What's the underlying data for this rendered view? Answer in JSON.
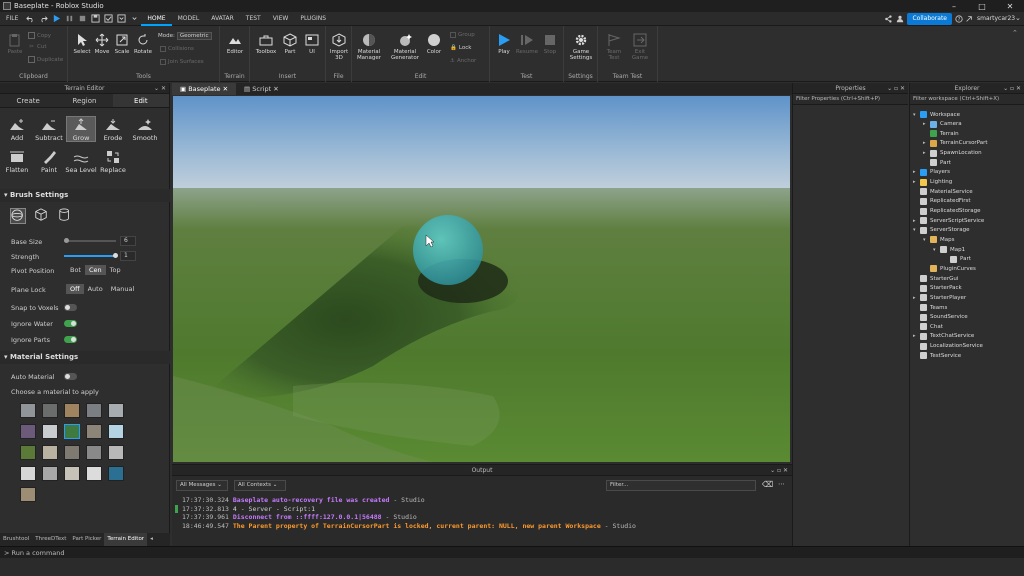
{
  "window": {
    "title": "Baseplate - Roblox Studio"
  },
  "menubar": {
    "items": [
      "FILE",
      "HOME",
      "MODEL",
      "AVATAR",
      "TEST",
      "VIEW",
      "PLUGINS"
    ],
    "active": "HOME",
    "collaborate": "Collaborate",
    "user": "smartycar23"
  },
  "ribbon": {
    "clipboard": {
      "paste": "Paste",
      "copy": "Copy",
      "cut": "Cut",
      "duplicate": "Duplicate",
      "label": "Clipboard"
    },
    "tools": {
      "select": "Select",
      "move": "Move",
      "scale": "Scale",
      "rotate": "Rotate",
      "mode_label": "Mode:",
      "mode_value": "Geometric",
      "collisions": "Collisions",
      "join": "Join Surfaces",
      "label": "Tools"
    },
    "terrain": {
      "editor": "Editor",
      "label": "Terrain"
    },
    "insert": {
      "toolbox": "Toolbox",
      "part": "Part",
      "ui": "UI",
      "label": "Insert"
    },
    "file": {
      "import": "Import 3D",
      "label": "File"
    },
    "edit": {
      "material": "Material Manager",
      "generator": "Material Generator",
      "color": "Color",
      "group": "Group",
      "lock": "Lock",
      "anchor": "Anchor",
      "label": "Edit"
    },
    "test": {
      "play": "Play",
      "resume": "Resume",
      "stop": "Stop",
      "label": "Test"
    },
    "settings": {
      "game": "Game Settings",
      "label": "Settings"
    },
    "teamtest": {
      "team": "Team Test",
      "exit": "Exit Game",
      "label": "Team Test"
    }
  },
  "terrain_editor": {
    "title": "Terrain Editor",
    "tabs": [
      "Create",
      "Region",
      "Edit"
    ],
    "active_tab": "Edit",
    "tools": [
      "Add",
      "Subtract",
      "Grow",
      "Erode",
      "Smooth",
      "Flatten",
      "Paint",
      "Sea Level",
      "Replace"
    ],
    "selected_tool": "Grow",
    "brush_settings": "Brush Settings",
    "base_size_label": "Base Size",
    "base_size": "6",
    "strength_label": "Strength",
    "strength": "1",
    "pivot_label": "Pivot Position",
    "pivot_options": [
      "Bot",
      "Cen",
      "Top"
    ],
    "pivot_selected": "Cen",
    "plane_label": "Plane Lock",
    "plane_options": [
      "Off",
      "Auto",
      "Manual"
    ],
    "plane_selected": "Off",
    "snap_label": "Snap to Voxels",
    "snap": false,
    "ignore_water_label": "Ignore Water",
    "ignore_water": true,
    "ignore_parts_label": "Ignore Parts",
    "ignore_parts": true,
    "material_settings": "Material Settings",
    "auto_material_label": "Auto Material",
    "auto_material": false,
    "choose_label": "Choose a material to apply"
  },
  "bottom_tabs": [
    "Brushtool",
    "ThreeDText",
    "Part Picker",
    "Terrain Editor"
  ],
  "viewport_tabs": [
    "Baseplate",
    "Script"
  ],
  "output": {
    "title": "Output",
    "filter1": "All Messages",
    "filter2": "All Contexts",
    "filter_placeholder": "Filter...",
    "lines": [
      {
        "time": "17:37:30.324",
        "text": "Baseplate auto-recovery file was created",
        "src": "Studio",
        "color": "#c77bff"
      },
      {
        "time": "17:37:32.813",
        "text": "4  -  Server - Script:1",
        "src": "",
        "color": "#cfcfcf"
      },
      {
        "time": "17:37:39.961",
        "text": "Disconnect from ::ffff:127.0.0.1|56488",
        "src": "Studio",
        "color": "#c77bff"
      },
      {
        "time": "18:46:49.547",
        "text": "The Parent property of TerrainCursorPart is locked, current parent: NULL, new parent Workspace",
        "src": "Studio",
        "color": "#ff9a2e"
      }
    ]
  },
  "properties": {
    "title": "Properties",
    "filter": "Filter Properties (Ctrl+Shift+P)"
  },
  "explorer": {
    "title": "Explorer",
    "filter": "Filter workspace (Ctrl+Shift+X)",
    "items": [
      "Workspace",
      "Camera",
      "Terrain",
      "TerrainCursorPart",
      "SpawnLocation",
      "Part",
      "Players",
      "Lighting",
      "MaterialService",
      "ReplicatedFirst",
      "ReplicatedStorage",
      "ServerScriptService",
      "ServerStorage",
      "Maps",
      "Map1",
      "Part",
      "PluginCurves",
      "StarterGui",
      "StarterPack",
      "StarterPlayer",
      "Teams",
      "SoundService",
      "Chat",
      "TextChatService",
      "LocalizationService",
      "TestService"
    ]
  },
  "command": {
    "placeholder": "Run a command"
  }
}
